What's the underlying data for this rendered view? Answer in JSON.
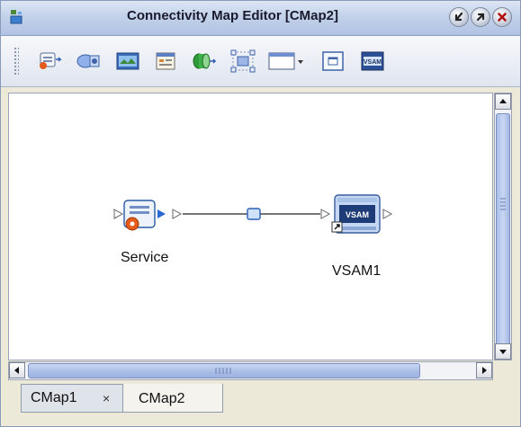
{
  "window": {
    "title": "Connectivity Map Editor [CMap2]",
    "buttons": [
      "minimize-icon",
      "maximize-icon",
      "close-icon"
    ]
  },
  "toolbar": {
    "tools": [
      "external-application-icon",
      "service-component-icon",
      "web-service-icon",
      "document-icon",
      "connector-icon",
      "auto-layout-icon",
      "window-dropdown-icon",
      "window-icon",
      "vsam-icon"
    ]
  },
  "diagram": {
    "nodes": [
      {
        "name": "Service",
        "type": "service"
      },
      {
        "name": "VSAM1",
        "type": "vsam",
        "badge": "VSAM"
      }
    ],
    "link": {
      "from": "Service",
      "to": "VSAM1"
    }
  },
  "tabs": [
    {
      "label": "CMap1",
      "close": "×",
      "active": false
    },
    {
      "label": "CMap2",
      "active": true
    }
  ],
  "colors": {
    "titlebar": "#c3d2ea",
    "scrollbar_thumb": "#b3c5ec",
    "window_bg": "#ece9d8"
  }
}
